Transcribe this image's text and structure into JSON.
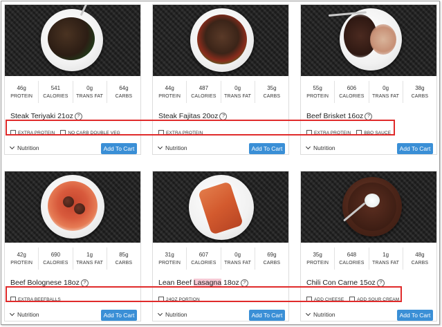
{
  "meals": [
    {
      "name": "Steak Teriyaki 21oz",
      "nutrition": [
        {
          "value": "46g",
          "label": "PROTEIN"
        },
        {
          "value": "541",
          "label": "CALORIES"
        },
        {
          "value": "0g",
          "label": "TRANS FAT"
        },
        {
          "value": "64g",
          "label": "CARBS"
        }
      ],
      "options": [
        "EXTRA PROTEIN",
        "NO CARB DOUBLE VEG"
      ],
      "nutrition_toggle": "Nutrition",
      "cart_label": "Add To Cart"
    },
    {
      "name": "Steak Fajitas 20oz",
      "nutrition": [
        {
          "value": "44g",
          "label": "PROTEIN"
        },
        {
          "value": "487",
          "label": "CALORIES"
        },
        {
          "value": "0g",
          "label": "TRANS FAT"
        },
        {
          "value": "35g",
          "label": "CARBS"
        }
      ],
      "options": [
        "EXTRA PROTEIN"
      ],
      "nutrition_toggle": "Nutrition",
      "cart_label": "Add To Cart"
    },
    {
      "name": "Beef Brisket 16oz",
      "nutrition": [
        {
          "value": "55g",
          "label": "PROTEIN"
        },
        {
          "value": "606",
          "label": "CALORIES"
        },
        {
          "value": "0g",
          "label": "TRANS FAT"
        },
        {
          "value": "38g",
          "label": "CARBS"
        }
      ],
      "options": [
        "EXTRA PROTEIN",
        "BBQ SAUCE"
      ],
      "nutrition_toggle": "Nutrition",
      "cart_label": "Add To Cart"
    },
    {
      "name": "Beef Bolognese 18oz",
      "nutrition": [
        {
          "value": "42g",
          "label": "PROTEIN"
        },
        {
          "value": "690",
          "label": "CALORIES"
        },
        {
          "value": "1g",
          "label": "TRANS FAT"
        },
        {
          "value": "85g",
          "label": "CARBS"
        }
      ],
      "options": [
        "EXTRA BEEFBALLS"
      ],
      "nutrition_toggle": "Nutrition",
      "cart_label": "Add To Cart"
    },
    {
      "name_prefix": "Lean Beef ",
      "name_highlight": "Lasagna",
      "name_suffix": " 18oz",
      "nutrition": [
        {
          "value": "31g",
          "label": "PROTEIN"
        },
        {
          "value": "607",
          "label": "CALORIES"
        },
        {
          "value": "0g",
          "label": "TRANS FAT"
        },
        {
          "value": "69g",
          "label": "CARBS"
        }
      ],
      "options": [
        "24OZ PORTION"
      ],
      "nutrition_toggle": "Nutrition",
      "cart_label": "Add To Cart"
    },
    {
      "name": "Chili Con Carne 15oz",
      "nutrition": [
        {
          "value": "35g",
          "label": "PROTEIN"
        },
        {
          "value": "648",
          "label": "CALORIES"
        },
        {
          "value": "1g",
          "label": "TRANS FAT"
        },
        {
          "value": "48g",
          "label": "CARBS"
        }
      ],
      "options": [
        "ADD CHEESE",
        "ADD SOUR CREAM"
      ],
      "nutrition_toggle": "Nutrition",
      "cart_label": "Add To Cart"
    }
  ],
  "info_icon": "info-icon",
  "colors": {
    "cart_button": "#3a8fd6",
    "highlight_box": "#e02a2a",
    "text_highlight": "#f6cad5"
  }
}
